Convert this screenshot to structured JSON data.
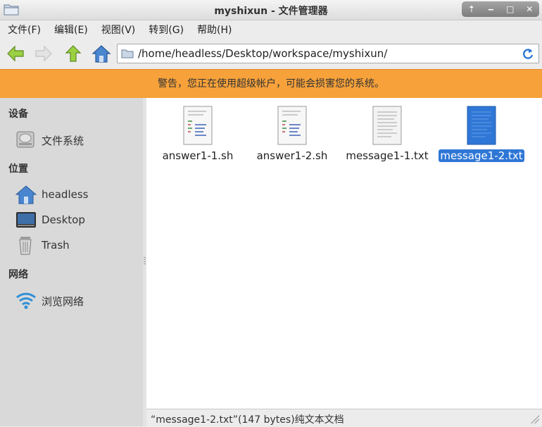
{
  "window": {
    "title": "myshixun - 文件管理器",
    "controls": [
      "up-icon",
      "minimize-icon",
      "maximize-icon",
      "close-icon"
    ]
  },
  "menu": [
    "文件(F)",
    "编辑(E)",
    "视图(V)",
    "转到(G)",
    "帮助(H)"
  ],
  "toolbar": {
    "back_icon": "arrow-left-icon",
    "forward_icon": "arrow-right-icon",
    "up_icon": "arrow-up-icon",
    "home_icon": "home-icon",
    "location": "/home/headless/Desktop/workspace/myshixun/",
    "refresh_icon": "refresh-icon"
  },
  "warning": "警告，您正在使用超级帐户，可能会损害您的系统。",
  "sidebar": {
    "devices_heading": "设备",
    "devices": [
      {
        "label": "文件系统",
        "icon": "drive-icon"
      }
    ],
    "places_heading": "位置",
    "places": [
      {
        "label": "headless",
        "icon": "home-icon"
      },
      {
        "label": "Desktop",
        "icon": "desktop-icon"
      },
      {
        "label": "Trash",
        "icon": "trash-icon"
      }
    ],
    "network_heading": "网络",
    "network": [
      {
        "label": "浏览网络",
        "icon": "wifi-icon"
      }
    ]
  },
  "files": [
    {
      "name": "answer1-1.sh",
      "icon": "script-file-icon",
      "selected": false
    },
    {
      "name": "answer1-2.sh",
      "icon": "script-file-icon",
      "selected": false
    },
    {
      "name": "message1-1.txt",
      "icon": "text-file-icon",
      "selected": false
    },
    {
      "name": "message1-2.txt",
      "icon": "text-file-icon",
      "selected": true
    }
  ],
  "status": "“message1-2.txt”(147 bytes)纯文本文档",
  "colors": {
    "warning": "#f6a13a",
    "selection": "#2f77d6",
    "sidebar": "#d9d9d9"
  }
}
